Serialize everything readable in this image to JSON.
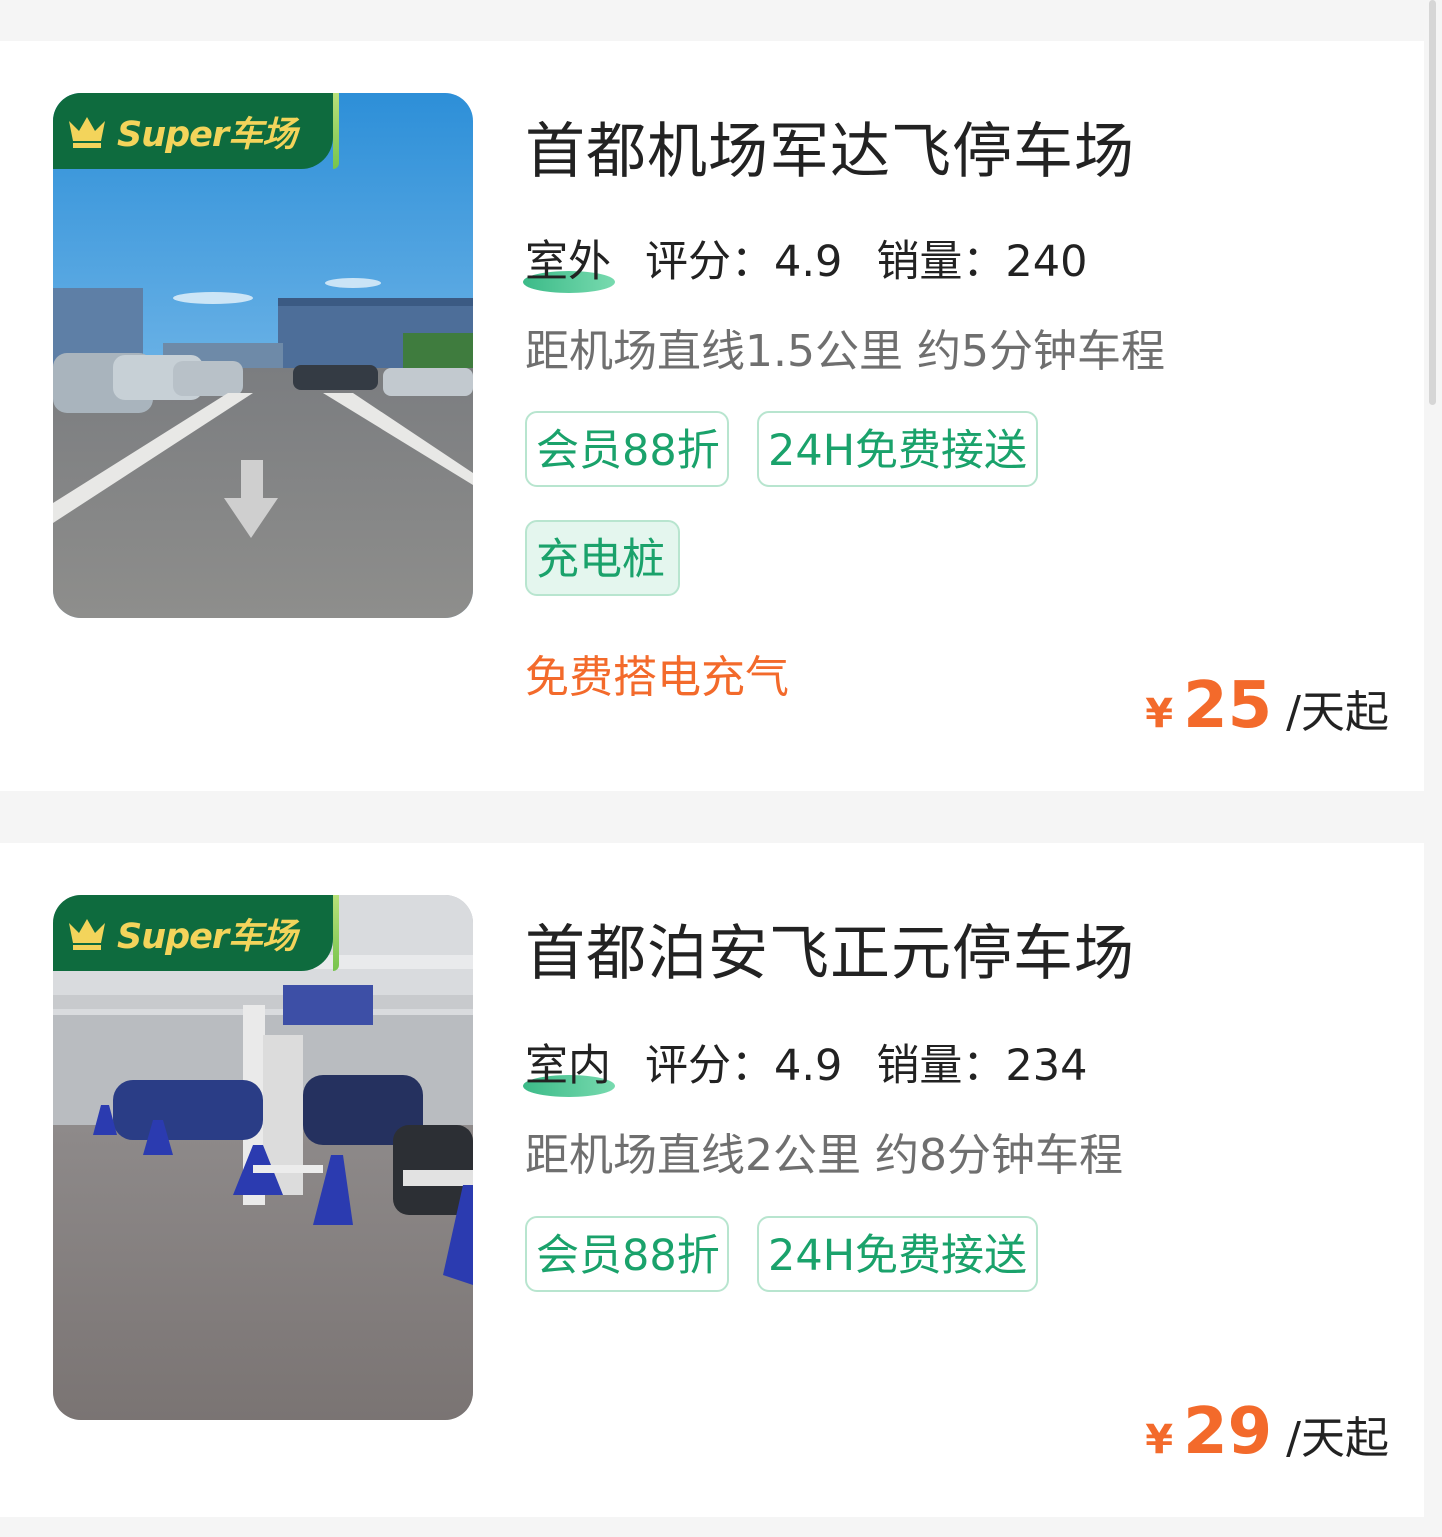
{
  "badge_label": "Super车场",
  "colors": {
    "accent": "#1aa26b",
    "price": "#f36a2b",
    "badge_bg": "#0e6b3e",
    "badge_text": "#f3d45b"
  },
  "listings": [
    {
      "image": "outdoor-parking-lot-photo",
      "name": "首都机场军达飞停车场",
      "location_type": "室外",
      "rating": "评分：4.9",
      "sales": "销量：240",
      "distance": "距机场直线1.5公里 约5分钟车程",
      "tags": [
        "会员88折",
        "24H免费接送",
        "充电桩"
      ],
      "promo": "免费搭电充气",
      "currency": "¥",
      "price": "25",
      "price_unit": "/天起"
    },
    {
      "image": "indoor-parking-garage-photo",
      "name": "首都泊安飞正元停车场",
      "location_type": "室内",
      "rating": "评分：4.9",
      "sales": "销量：234",
      "distance": "距机场直线2公里 约8分钟车程",
      "tags": [
        "会员88折",
        "24H免费接送"
      ],
      "currency": "¥",
      "price": "29",
      "price_unit": "/天起"
    }
  ]
}
